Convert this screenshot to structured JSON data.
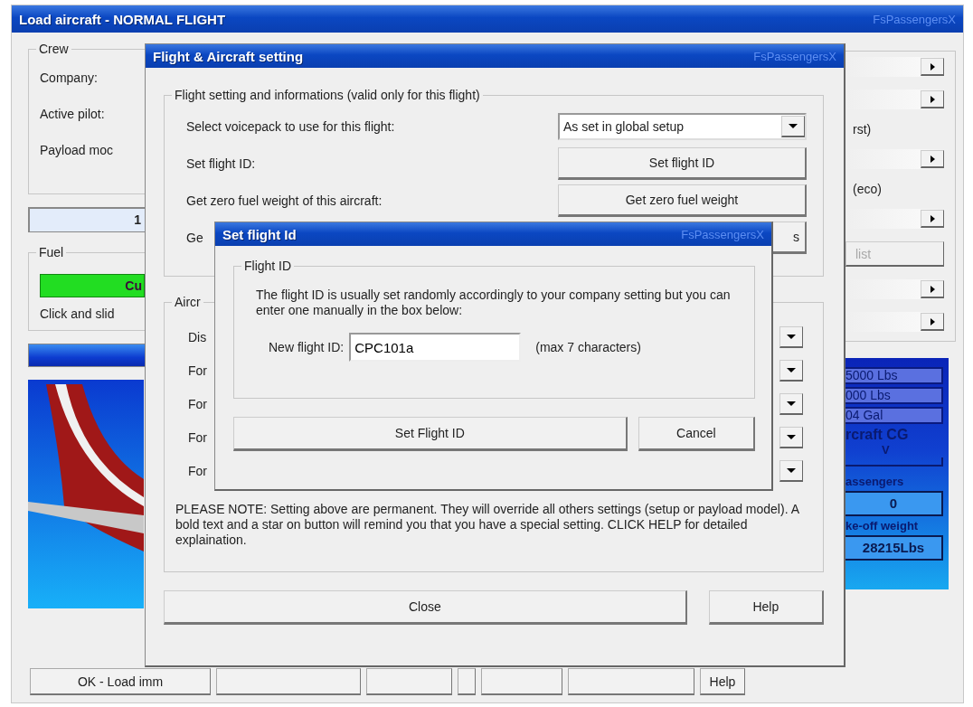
{
  "main_window": {
    "title": "Load aircraft - NORMAL FLIGHT",
    "brand": "FsPassengersX",
    "crew": {
      "legend": "Crew",
      "labels": [
        "Company:",
        "Active pilot:",
        "Payload moc"
      ]
    },
    "counter_field": {
      "value": "1"
    },
    "fuel": {
      "legend": "Fuel",
      "button": "Cu",
      "hint": "Click and slid"
    },
    "right_panel": {
      "items": [
        {
          "kind": "arrow"
        },
        {
          "kind": "arrow"
        },
        {
          "kind": "text_arrow",
          "text": "rst)"
        },
        {
          "kind": "text_arrow",
          "text": "(eco)"
        },
        {
          "kind": "button",
          "text": "list",
          "disabled": true
        },
        {
          "kind": "arrow"
        },
        {
          "kind": "arrow"
        }
      ]
    },
    "info_panel": {
      "weights": [
        "5000 Lbs",
        "000 Lbs",
        "04 Gal"
      ],
      "cg_label": "rcraft CG",
      "cg_marker": "V",
      "passengers_label": "assengers",
      "passengers": "0",
      "takeoff_label": "ke-off weight",
      "takeoff": "28215Lbs"
    },
    "bottom_buttons": [
      {
        "kind": "label",
        "label": "OK - Load imm"
      },
      {
        "kind": "blank"
      },
      {
        "kind": "blank"
      },
      {
        "kind": "blank"
      },
      {
        "kind": "blank"
      },
      {
        "kind": "blank"
      },
      {
        "kind": "label",
        "label": "Help"
      }
    ]
  },
  "flight_dialog": {
    "title": "Flight & Aircraft setting",
    "brand": "FsPassengersX",
    "flight_group": {
      "legend": "Flight setting and informations (valid only for this flight)",
      "rows": [
        {
          "label": "Select voicepack to use for this flight:",
          "kind": "select",
          "value": "As set in global setup"
        },
        {
          "label": "Set flight ID:",
          "kind": "button",
          "value": "Set flight ID"
        },
        {
          "label": "Get zero fuel weight of this aircraft:",
          "kind": "button",
          "value": "Get zero fuel weight"
        },
        {
          "label": "Ge",
          "kind": "button",
          "value": "s"
        }
      ]
    },
    "aircraft_group": {
      "legend": "Aircr",
      "rows": [
        "Dis",
        "For",
        "For",
        "For",
        "For"
      ],
      "note": "PLEASE NOTE: Setting above are permanent. They will override all others settings (setup or payload model). A bold text and a star on button will remind you that you have a special setting. CLICK HELP for detailed explaination."
    },
    "buttons": [
      "Close",
      "Help"
    ]
  },
  "id_dialog": {
    "title": "Set flight Id",
    "brand": "FsPassengersX",
    "legend": "Flight ID",
    "text": "The flight ID is usually set randomly accordingly to your company setting but you can enter one manually in the box below:",
    "field_label": "New flight ID:",
    "field_value": "CPC101a",
    "field_hint": "(max 7 characters)",
    "buttons": [
      "Set Flight ID",
      "Cancel"
    ]
  }
}
